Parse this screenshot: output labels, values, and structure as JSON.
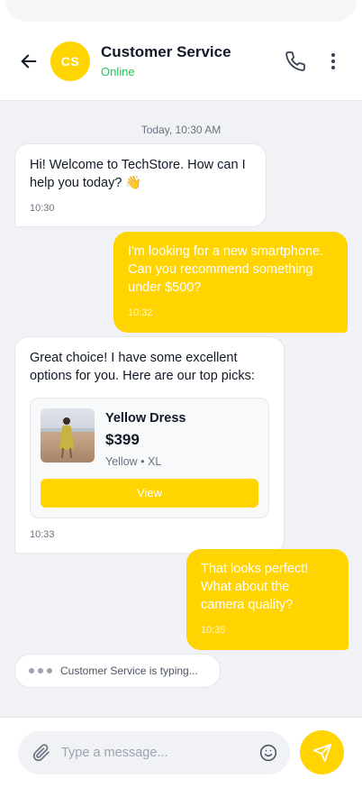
{
  "header": {
    "avatar_initials": "CS",
    "name": "Customer Service",
    "status": "Online"
  },
  "chat": {
    "date_separator": "Today, 10:30 AM",
    "messages": [
      {
        "direction": "incoming",
        "text": "Hi! Welcome to TechStore. How can I help you today? 👋",
        "time": "10:30"
      },
      {
        "direction": "outgoing",
        "text": "I'm looking for a new smartphone. Can you recommend something under $500?",
        "time": "10:32"
      },
      {
        "direction": "incoming",
        "text": "Great choice! I have some excellent options for you. Here are our top picks:",
        "time": "10:33"
      },
      {
        "direction": "outgoing",
        "text": "That looks perfect! What about the camera quality?",
        "time": "10:35"
      }
    ],
    "product_card": {
      "name": "Yellow Dress",
      "price": "$399",
      "variant": "Yellow • XL",
      "button_label": "View",
      "image": "woman-in-yellow-dress-on-beach"
    },
    "typing_indicator": "Customer Service is typing..."
  },
  "composer": {
    "placeholder": "Type a message...",
    "value": ""
  },
  "icons": {
    "back": "arrow-left-icon",
    "call": "phone-icon",
    "more": "more-vertical-icon",
    "attach": "paperclip-icon",
    "emoji": "smile-icon",
    "send": "send-icon"
  },
  "colors": {
    "accent": "#ffd400",
    "online": "#22c55e",
    "chat_background": "#f0f2f6"
  }
}
